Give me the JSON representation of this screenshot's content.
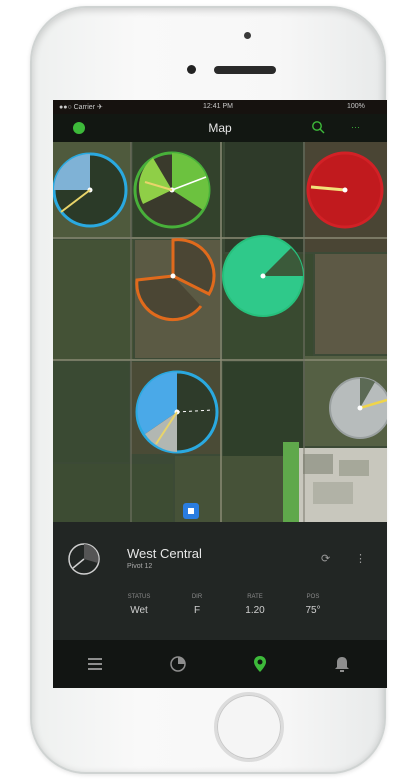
{
  "status_bar": {
    "carrier": "●●○ Carrier ✈",
    "time": "12:41 PM",
    "battery": "100%"
  },
  "nav": {
    "title": "Map",
    "right_action": "···",
    "left_icon": "green-dot-icon",
    "search_icon": "search-icon"
  },
  "map": {
    "pivots": [
      {
        "name": "pivot-blue-topleft",
        "ring_color": "#2aa9e0",
        "fill": "#7fb2d6",
        "sector_deg": 90
      },
      {
        "name": "pivot-green-top",
        "ring_color": "#48b03a",
        "fill": "#6cc23f",
        "sector_deg": 200
      },
      {
        "name": "pivot-red-right",
        "ring_color": "#c8181c",
        "fill": "#c11a1e",
        "sector_deg": 360
      },
      {
        "name": "pivot-orange-partial",
        "ring_color": "#e06a1c",
        "fill": "#3e3a2e",
        "sector_deg": 250
      },
      {
        "name": "pivot-teal-center",
        "ring_color": "#27c07c",
        "fill": "#2fc98a",
        "sector_deg": 300
      },
      {
        "name": "pivot-blue-bottom",
        "ring_color": "#2aa9e0",
        "fill": "#4aa9e8",
        "sector_deg": 120
      },
      {
        "name": "pivot-gray-right",
        "ring_color": "#9aa0a0",
        "fill": "#b7bcbc",
        "sector_deg": 340
      }
    ],
    "location_marker_color": "#2a7de0"
  },
  "panel": {
    "field_name": "West Central",
    "field_sub": "Pivot 12",
    "actions": [
      "⟳",
      "⋮"
    ],
    "stats": [
      {
        "key": "STATUS",
        "value": "Wet"
      },
      {
        "key": "DIR",
        "value": "F"
      },
      {
        "key": "RATE",
        "value": "1.20"
      },
      {
        "key": "POS",
        "value": "75°"
      }
    ]
  },
  "tabs": [
    {
      "name": "tab-list",
      "icon": "list-icon",
      "active": false
    },
    {
      "name": "tab-fields",
      "icon": "pivot-icon",
      "active": false
    },
    {
      "name": "tab-map",
      "icon": "map-pin-icon",
      "active": true
    },
    {
      "name": "tab-notifications",
      "icon": "bell-icon",
      "active": false
    }
  ],
  "colors": {
    "accent": "#3dba3a",
    "panel_bg": "#222624",
    "tab_bg": "#121513"
  }
}
